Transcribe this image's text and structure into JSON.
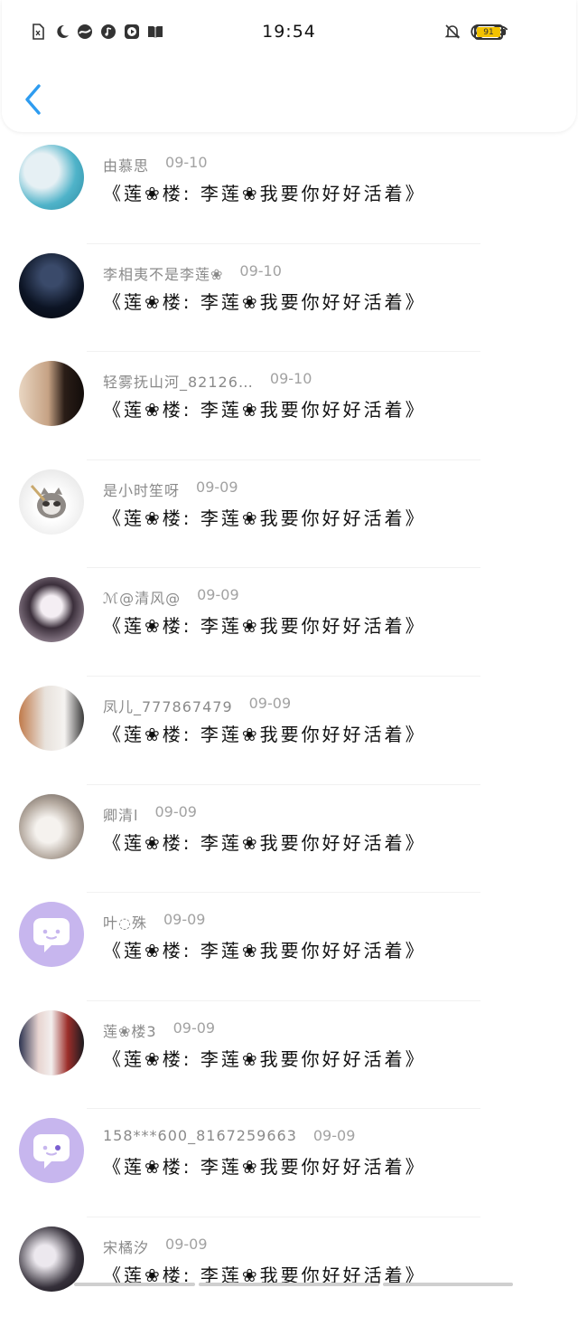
{
  "status_bar": {
    "time": "19:54",
    "battery": "91",
    "left_icons": [
      "sim-card-icon",
      "moon-icon",
      "wavy-app-icon",
      "music-note-icon",
      "play-icon",
      "book-icon"
    ],
    "right_icons": [
      "bell-off-icon",
      "moon-icon",
      "wifi-icon"
    ]
  },
  "header": {
    "back_icon": "chevron-left-icon"
  },
  "comments": [
    {
      "name": "由慕思",
      "date": "09-10",
      "text": "《莲❀楼: 李莲❀我要你好好活着》"
    },
    {
      "name": "李相夷不是李莲❀",
      "date": "09-10",
      "text": "《莲❀楼: 李莲❀我要你好好活着》"
    },
    {
      "name": "轻雾抚山河_82126…",
      "date": "09-10",
      "text": "《莲❀楼: 李莲❀我要你好好活着》"
    },
    {
      "name": "是小时笙呀",
      "date": "09-09",
      "text": "《莲❀楼: 李莲❀我要你好好活着》"
    },
    {
      "name": "ℳ@清风@",
      "date": "09-09",
      "text": "《莲❀楼: 李莲❀我要你好好活着》"
    },
    {
      "name": "凤儿_777867479",
      "date": "09-09",
      "text": "《莲❀楼: 李莲❀我要你好好活着》"
    },
    {
      "name": "卿清l",
      "date": "09-09",
      "text": "《莲❀楼: 李莲❀我要你好好活着》"
    },
    {
      "name": "叶◌殊",
      "date": "09-09",
      "text": "《莲❀楼: 李莲❀我要你好好活着》"
    },
    {
      "name": "莲❀楼3",
      "date": "09-09",
      "text": "《莲❀楼: 李莲❀我要你好好活着》"
    },
    {
      "name": "158***600_8167259663",
      "date": "09-09",
      "text": "《莲❀楼: 李莲❀我要你好好活着》"
    },
    {
      "name": "宋橘汐",
      "date": "09-09",
      "text": "《莲❀楼: 李莲❀我要你好好活着》"
    }
  ],
  "colors": {
    "accent": "#2e9cf0",
    "meta_text": "#8a8a8a",
    "default_avatar": "#c7b6ee",
    "battery": "#f2c200"
  }
}
